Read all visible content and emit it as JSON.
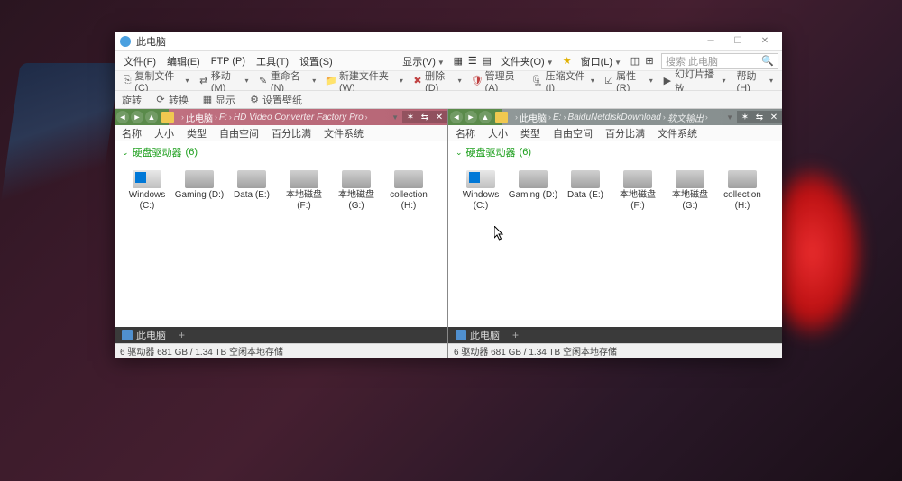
{
  "title": "此电脑",
  "menu": {
    "file": "文件(F)",
    "edit": "编辑(E)",
    "ftp": "FTP (P)",
    "tools": "工具(T)",
    "settings": "设置(S)",
    "view": "显示(V)",
    "folder": "文件夹(O)",
    "window": "窗口(L)",
    "search_placeholder": "搜索 此电脑",
    "help": "帮助(H)"
  },
  "toolbar": {
    "copy": "复制文件(C)",
    "move": "移动(M)",
    "rename": "重命名(N)",
    "newfolder": "新建文件夹(W)",
    "delete": "删除(D)",
    "admin": "管理员(A)",
    "compress": "压缩文件(I)",
    "properties": "属性(R)",
    "slideshow": "幻灯片播放"
  },
  "toolbar2": {
    "spin": "旋转",
    "convert": "转换",
    "show": "显示",
    "wallpaper": "设置壁纸"
  },
  "columns": [
    "名称",
    "大小",
    "类型",
    "自由空间",
    "百分比满",
    "文件系统"
  ],
  "group": {
    "label": "硬盘驱动器",
    "count": "(6)"
  },
  "left_panel": {
    "path": {
      "root": "此电脑",
      "drive": "F:",
      "folder": "HD Video Converter Factory Pro"
    },
    "drives": [
      {
        "name": "Windows (C:)",
        "type": "windows"
      },
      {
        "name": "Gaming (D:)",
        "type": "hdd"
      },
      {
        "name": "Data (E:)",
        "type": "hdd"
      },
      {
        "name": "本地磁盘 (F:)",
        "type": "hdd"
      },
      {
        "name": "本地磁盘 (G:)",
        "type": "hdd"
      },
      {
        "name": "collection (H:)",
        "type": "hdd"
      }
    ],
    "tab": "此电脑",
    "status": "6 驱动器  681 GB / 1.34 TB 空闲本地存储"
  },
  "right_panel": {
    "path": {
      "root": "此电脑",
      "drive": "E:",
      "folder1": "BaiduNetdiskDownload",
      "folder2": "软文输出"
    },
    "drives": [
      {
        "name": "Windows (C:)",
        "type": "windows"
      },
      {
        "name": "Gaming (D:)",
        "type": "hdd"
      },
      {
        "name": "Data (E:)",
        "type": "hdd"
      },
      {
        "name": "本地磁盘 (F:)",
        "type": "hdd"
      },
      {
        "name": "本地磁盘 (G:)",
        "type": "hdd"
      },
      {
        "name": "collection (H:)",
        "type": "hdd"
      }
    ],
    "tab": "此电脑",
    "status": "6 驱动器  681 GB / 1.34 TB 空闲本地存储"
  }
}
